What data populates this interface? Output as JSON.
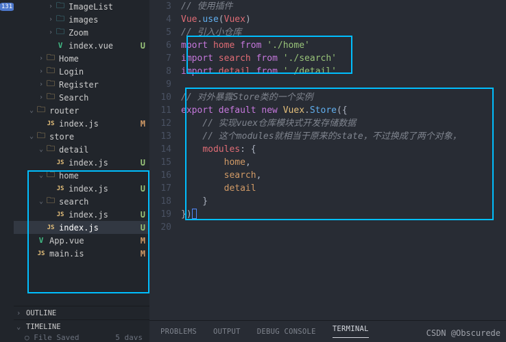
{
  "activity_bar": {
    "badge": "131"
  },
  "sidebar": {
    "tree": [
      {
        "depth": 3,
        "chev": "›",
        "icon": "folder-green",
        "name": "ImageList",
        "status": ""
      },
      {
        "depth": 3,
        "chev": "›",
        "icon": "folder-green",
        "name": "images",
        "status": ""
      },
      {
        "depth": 3,
        "chev": "›",
        "icon": "folder-green",
        "name": "Zoom",
        "status": ""
      },
      {
        "depth": 3,
        "chev": "",
        "icon": "vue",
        "name": "index.vue",
        "status": "U"
      },
      {
        "depth": 2,
        "chev": "›",
        "icon": "folder",
        "name": "Home",
        "status": ""
      },
      {
        "depth": 2,
        "chev": "›",
        "icon": "folder",
        "name": "Login",
        "status": ""
      },
      {
        "depth": 2,
        "chev": "›",
        "icon": "folder",
        "name": "Register",
        "status": ""
      },
      {
        "depth": 2,
        "chev": "›",
        "icon": "folder",
        "name": "Search",
        "status": ""
      },
      {
        "depth": 1,
        "chev": "⌄",
        "icon": "folder",
        "name": "router",
        "status": ""
      },
      {
        "depth": 2,
        "chev": "",
        "icon": "js",
        "name": "index.js",
        "status": "M"
      },
      {
        "depth": 1,
        "chev": "⌄",
        "icon": "folder",
        "name": "store",
        "status": ""
      },
      {
        "depth": 2,
        "chev": "⌄",
        "icon": "folder",
        "name": "detail",
        "status": ""
      },
      {
        "depth": 3,
        "chev": "",
        "icon": "js",
        "name": "index.js",
        "status": "U"
      },
      {
        "depth": 2,
        "chev": "⌄",
        "icon": "folder",
        "name": "home",
        "status": ""
      },
      {
        "depth": 3,
        "chev": "",
        "icon": "js",
        "name": "index.js",
        "status": "U"
      },
      {
        "depth": 2,
        "chev": "⌄",
        "icon": "folder",
        "name": "search",
        "status": ""
      },
      {
        "depth": 3,
        "chev": "",
        "icon": "js",
        "name": "index.js",
        "status": "U"
      },
      {
        "depth": 2,
        "chev": "",
        "icon": "js",
        "name": "index.js",
        "status": "U",
        "selected": true
      },
      {
        "depth": 1,
        "chev": "",
        "icon": "vue",
        "name": "App.vue",
        "status": "M"
      },
      {
        "depth": 1,
        "chev": "",
        "icon": "js",
        "name": "main.is",
        "status": "M"
      }
    ],
    "outline": "OUTLINE",
    "timeline": "TIMELINE",
    "timeline_item": "File Saved",
    "timeline_when": "5 davs"
  },
  "editor": {
    "lines": {
      "l3": {
        "num": "3",
        "tokens": [
          {
            "cls": "cm",
            "t": "// 使用插件"
          }
        ]
      },
      "l4": {
        "num": "4",
        "tokens": [
          {
            "cls": "id",
            "t": "Vue"
          },
          {
            "cls": "pu",
            "t": "."
          },
          {
            "cls": "fn",
            "t": "use"
          },
          {
            "cls": "pu",
            "t": "("
          },
          {
            "cls": "id",
            "t": "Vuex"
          },
          {
            "cls": "pu",
            "t": ")"
          }
        ]
      },
      "l5": {
        "num": "5",
        "tokens": [
          {
            "cls": "cm",
            "t": "// 引入小仓库"
          }
        ]
      },
      "l6": {
        "num": "6",
        "tokens": [
          {
            "cls": "cm",
            "t": ""
          }
        ]
      },
      "l7": {
        "num": "7",
        "tokens": [
          {
            "cls": "kw",
            "t": "mport "
          },
          {
            "cls": "id",
            "t": "home"
          },
          {
            "cls": "kw",
            "t": " from "
          },
          {
            "cls": "str",
            "t": "'./home'"
          }
        ]
      },
      "l8": {
        "num": "8",
        "tokens": [
          {
            "cls": "kw",
            "t": "import "
          },
          {
            "cls": "id",
            "t": "search"
          },
          {
            "cls": "kw",
            "t": " from "
          },
          {
            "cls": "str",
            "t": "'./search'"
          }
        ]
      },
      "l9": {
        "num": "9",
        "tokens": [
          {
            "cls": "kw",
            "t": "import "
          },
          {
            "cls": "id",
            "t": "detail"
          },
          {
            "cls": "kw",
            "t": " from "
          },
          {
            "cls": "str",
            "t": "'./detail'"
          }
        ]
      },
      "l10": {
        "num": "10",
        "tokens": []
      },
      "l11": {
        "num": "11",
        "tokens": [
          {
            "cls": "cm",
            "t": "// 对外暴露Store类的一个实例"
          }
        ]
      },
      "l12": {
        "num": "12",
        "tokens": [
          {
            "cls": "kw",
            "t": "export default new "
          },
          {
            "cls": "cls",
            "t": "Vuex"
          },
          {
            "cls": "pu",
            "t": "."
          },
          {
            "cls": "fn",
            "t": "Store"
          },
          {
            "cls": "pu",
            "t": "({"
          }
        ]
      },
      "l13": {
        "num": "13",
        "tokens": [
          {
            "cls": "cm",
            "t": "    // 实现vuex仓库模块式开发存储数据"
          }
        ]
      },
      "l14": {
        "num": "14",
        "tokens": [
          {
            "cls": "cm",
            "t": "    // 这个modules就相当于原来的state，不过换成了两个对象，"
          }
        ]
      },
      "l15": {
        "num": "15",
        "tokens": [
          {
            "cls": "pu",
            "t": "    "
          },
          {
            "cls": "id",
            "t": "modules"
          },
          {
            "cls": "pu",
            "t": ": {"
          }
        ]
      },
      "l16": {
        "num": "16",
        "tokens": [
          {
            "cls": "pu",
            "t": "        "
          },
          {
            "cls": "prop",
            "t": "home"
          },
          {
            "cls": "pu",
            "t": ","
          }
        ]
      },
      "l17": {
        "num": "17",
        "tokens": [
          {
            "cls": "pu",
            "t": "        "
          },
          {
            "cls": "prop",
            "t": "search"
          },
          {
            "cls": "pu",
            "t": ","
          }
        ]
      },
      "l18": {
        "num": "18",
        "tokens": [
          {
            "cls": "pu",
            "t": "        "
          },
          {
            "cls": "prop",
            "t": "detail"
          }
        ]
      },
      "l19": {
        "num": "19",
        "tokens": [
          {
            "cls": "pu",
            "t": "    }"
          }
        ]
      },
      "l20": {
        "num": "20",
        "tokens": [
          {
            "cls": "pu",
            "t": "})"
          }
        ]
      }
    },
    "line_order": [
      "l3",
      "l4",
      "l5",
      "l6",
      "l7",
      "l8",
      "l9",
      "l10",
      "l11",
      "l12",
      "l13",
      "l14",
      "l15",
      "l16",
      "l17",
      "l18",
      "l19",
      "l20"
    ]
  },
  "panel": {
    "tabs": {
      "problems": "PROBLEMS",
      "output": "OUTPUT",
      "debug": "DEBUG CONSOLE",
      "terminal": "TERMINAL"
    }
  },
  "watermark": "CSDN @Obscurede"
}
